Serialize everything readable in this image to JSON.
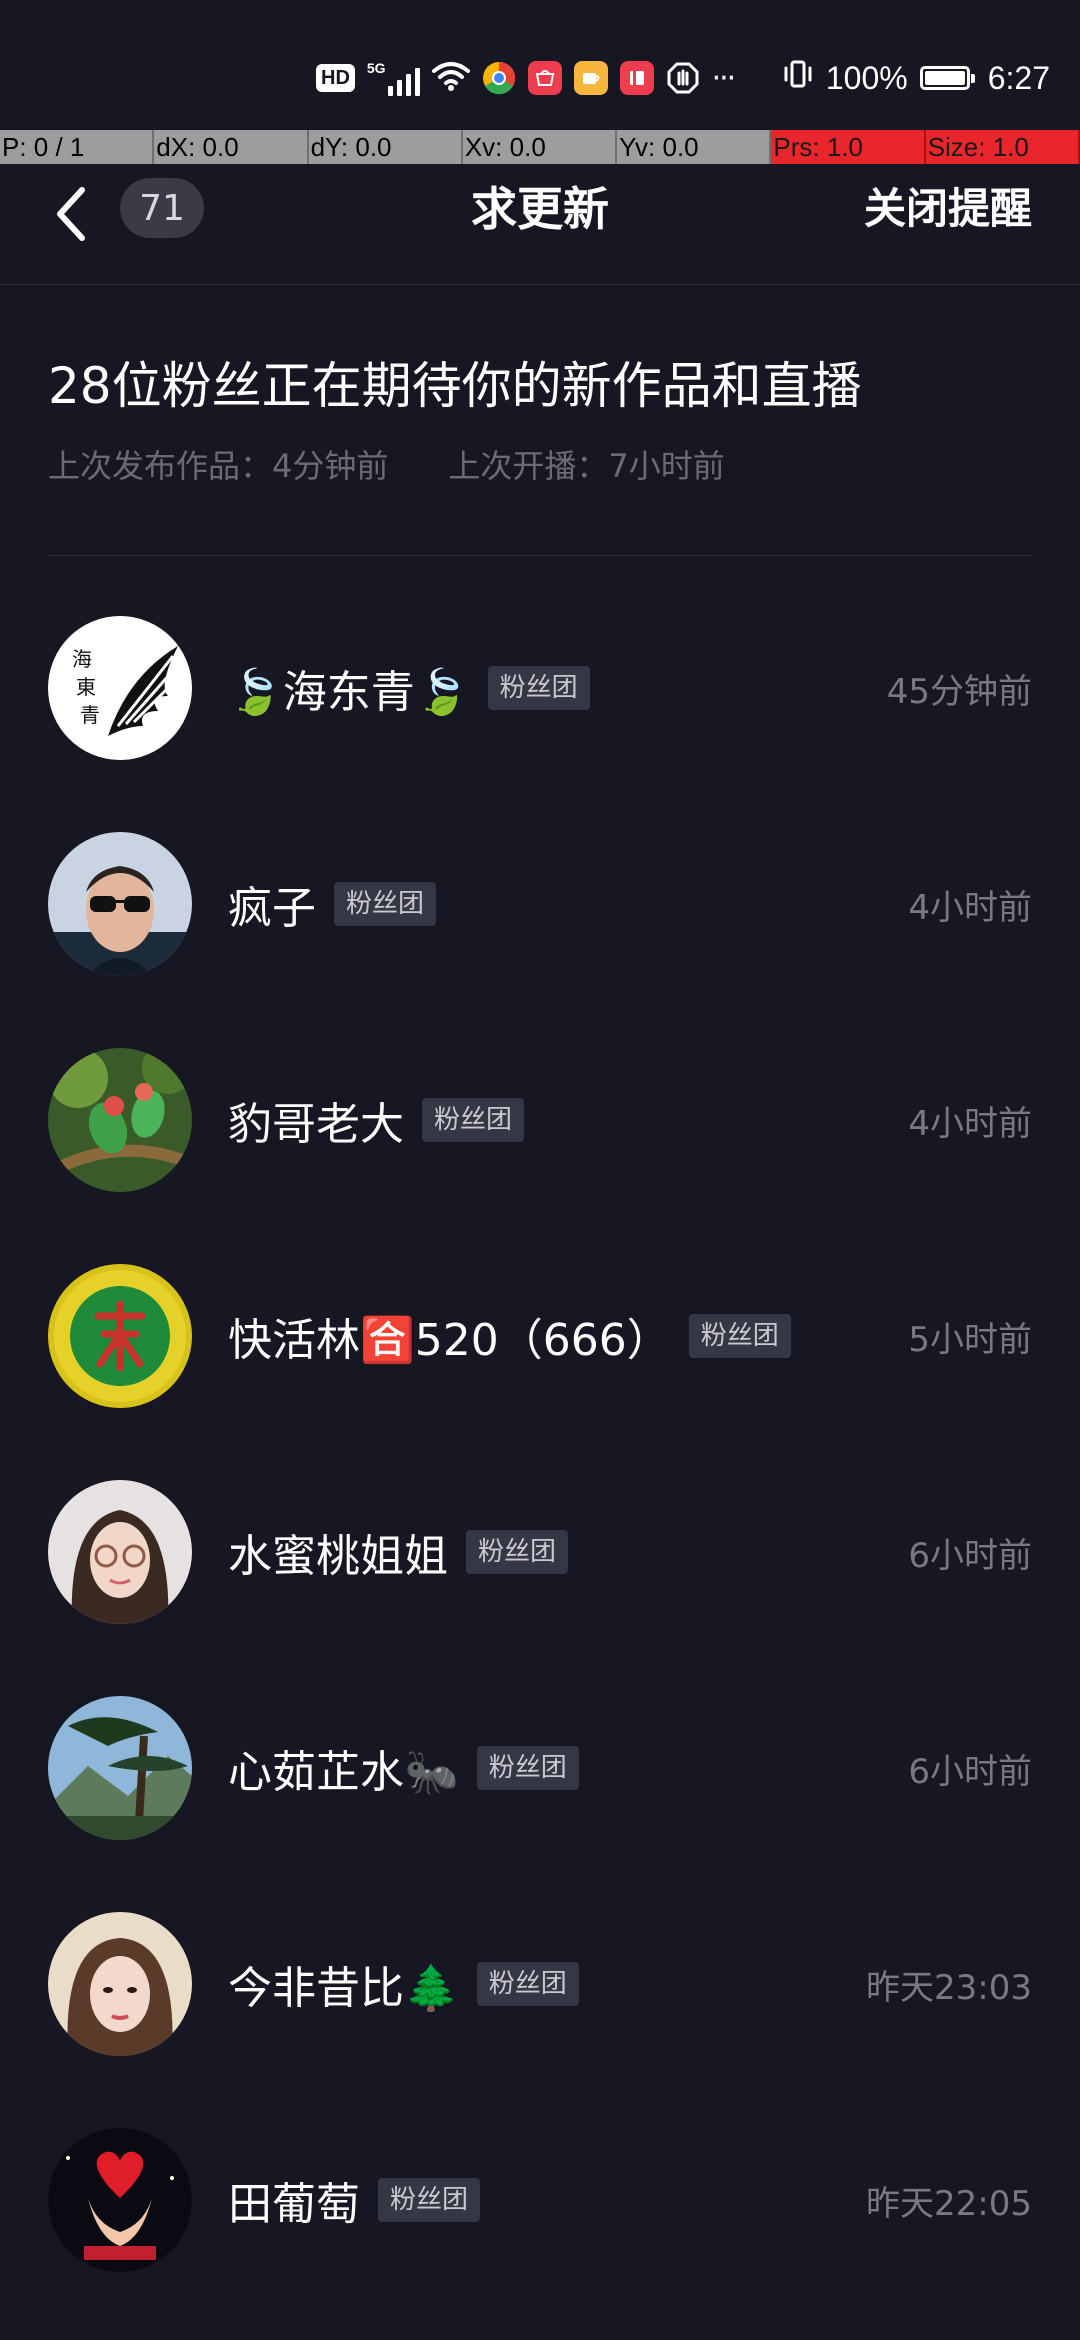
{
  "status_bar": {
    "hd_label": "HD",
    "network_label": "5G",
    "battery_percent": "100%",
    "time": "6:27",
    "more_glyph": "···",
    "icons": [
      "hd-icon",
      "signal-5g-icon",
      "wifi-icon",
      "chrome-like-app-icon",
      "huawei-app-icon",
      "cup-app-icon",
      "book-app-icon",
      "shield-app-icon",
      "vibrate-icon",
      "battery-icon"
    ]
  },
  "debug_overlay": {
    "cells": [
      {
        "text": "P: 0 / 1",
        "highlight": false
      },
      {
        "text": "dX: 0.0",
        "highlight": false
      },
      {
        "text": "dY: 0.0",
        "highlight": false
      },
      {
        "text": "Xv: 0.0",
        "highlight": false
      },
      {
        "text": "Yv: 0.0",
        "highlight": false
      },
      {
        "text": "Prs: 1.0",
        "highlight": true
      },
      {
        "text": "Size: 1.0",
        "highlight": true
      }
    ]
  },
  "header": {
    "back_icon": "chevron-left-icon",
    "count_badge": "71",
    "title": "求更新",
    "action_label": "关闭提醒"
  },
  "summary": {
    "title": "28位粉丝正在期待你的新作品和直播",
    "last_post": "上次发布作品：4分钟前",
    "last_live": "上次开播：7小时前"
  },
  "fans": [
    {
      "name": "🍃海东青🍃",
      "badge": "粉丝团",
      "time": "45分钟前",
      "avatar": "eagle-wing-avatar"
    },
    {
      "name": "疯子",
      "badge": "粉丝团",
      "time": "4小时前",
      "avatar": "man-sunglasses-avatar"
    },
    {
      "name": "豹哥老大",
      "badge": "粉丝团",
      "time": "4小时前",
      "avatar": "parrots-avatar"
    },
    {
      "name": "快活林🈴520（666）",
      "badge": "粉丝团",
      "time": "5小时前",
      "avatar": "lin-character-avatar"
    },
    {
      "name": "水蜜桃姐姐",
      "badge": "粉丝团",
      "time": "6小时前",
      "avatar": "woman-glasses-avatar"
    },
    {
      "name": "心茹芷水🐜",
      "badge": "粉丝团",
      "time": "6小时前",
      "avatar": "pine-mountain-avatar"
    },
    {
      "name": "今非昔比🌲",
      "badge": "粉丝团",
      "time": "昨天23:03",
      "avatar": "woman-portrait-avatar"
    },
    {
      "name": "田葡萄",
      "badge": "粉丝团",
      "time": "昨天22:05",
      "avatar": "heart-hands-avatar"
    }
  ],
  "colors": {
    "background": "#161722",
    "badge_bg": "#363744",
    "muted_text": "#6a6b75",
    "debug_red": "#e8262b",
    "debug_gray": "#9d9d9d"
  }
}
